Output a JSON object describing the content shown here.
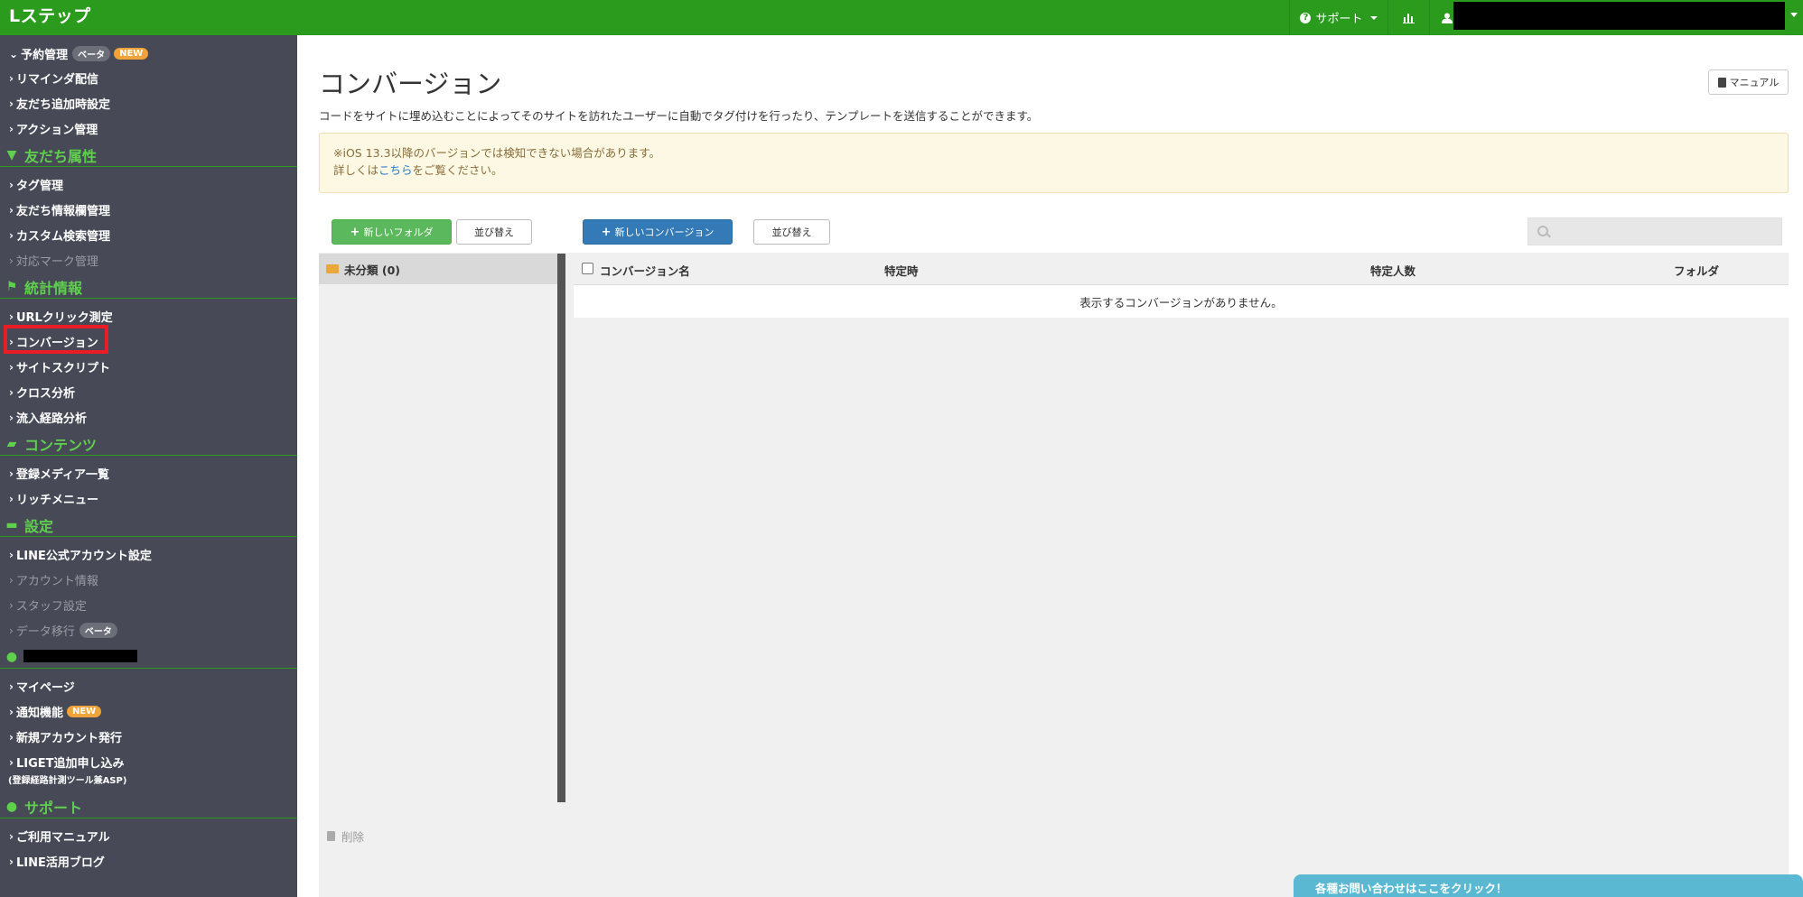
{
  "app": {
    "brand": "Lステップ"
  },
  "topbar": {
    "support_label": "サポート"
  },
  "sidebar": {
    "items_top": [
      {
        "label": "予約管理",
        "beta": "ベータ",
        "new": "NEW"
      },
      {
        "label": "リマインダ配信"
      },
      {
        "label": "友だち追加時設定"
      },
      {
        "label": "アクション管理"
      }
    ],
    "sections": [
      {
        "title": "友だち属性"
      },
      {
        "title": "統計情報"
      },
      {
        "title": "コンテンツ"
      },
      {
        "title": "設定"
      },
      {
        "title": ""
      },
      {
        "title": "サポート"
      }
    ],
    "attr_items": [
      "タグ管理",
      "友だち情報欄管理",
      "カスタム検索管理",
      "対応マーク管理"
    ],
    "stats_items": [
      "URLクリック測定",
      "コンバージョン",
      "サイトスクリプト",
      "クロス分析",
      "流入経路分析"
    ],
    "content_items": [
      "登録メディア一覧",
      "リッチメニュー"
    ],
    "settings_items": [
      "LINE公式アカウント設定",
      "アカウント情報",
      "スタッフ設定",
      "データ移行"
    ],
    "settings_beta": "ベータ",
    "account_items": [
      "マイページ",
      "通知機能",
      "新規アカウント発行",
      "LIGET追加申し込み"
    ],
    "account_new": "NEW",
    "liget_note": "(登録経路計測ツール兼ASP)",
    "support_items": [
      "ご利用マニュアル",
      "LINE活用ブログ"
    ]
  },
  "main": {
    "title": "コンバージョン",
    "manual_label": "マニュアル",
    "description": "コードをサイトに埋め込むことによってそのサイトを訪れたユーザーに自動でタグ付けを行ったり、テンプレートを送信することができます。",
    "alert_line1": "※iOS 13.3以降のバージョンでは検知できない場合があります。",
    "alert_line2_pre": "詳しくは",
    "alert_link": "こちら",
    "alert_line2_post": "をご覧ください。",
    "new_folder_label": "新しいフォルダ",
    "sort_label": "並び替え",
    "new_conversion_label": "新しいコンバージョン",
    "search_placeholder": "",
    "folder_name": "未分類 (0)",
    "table_headers": [
      "コンバージョン名",
      "特定時",
      "特定人数",
      "フォルダ"
    ],
    "empty_message": "表示するコンバージョンがありません。",
    "delete_label": "削除",
    "contact_label": "各種お問い合わせはここをクリック！"
  },
  "colors": {
    "topbar": "#2a9b1d",
    "sidebar": "#474a56",
    "section_text": "#5fd04e",
    "highlight": "#ec1c24"
  }
}
